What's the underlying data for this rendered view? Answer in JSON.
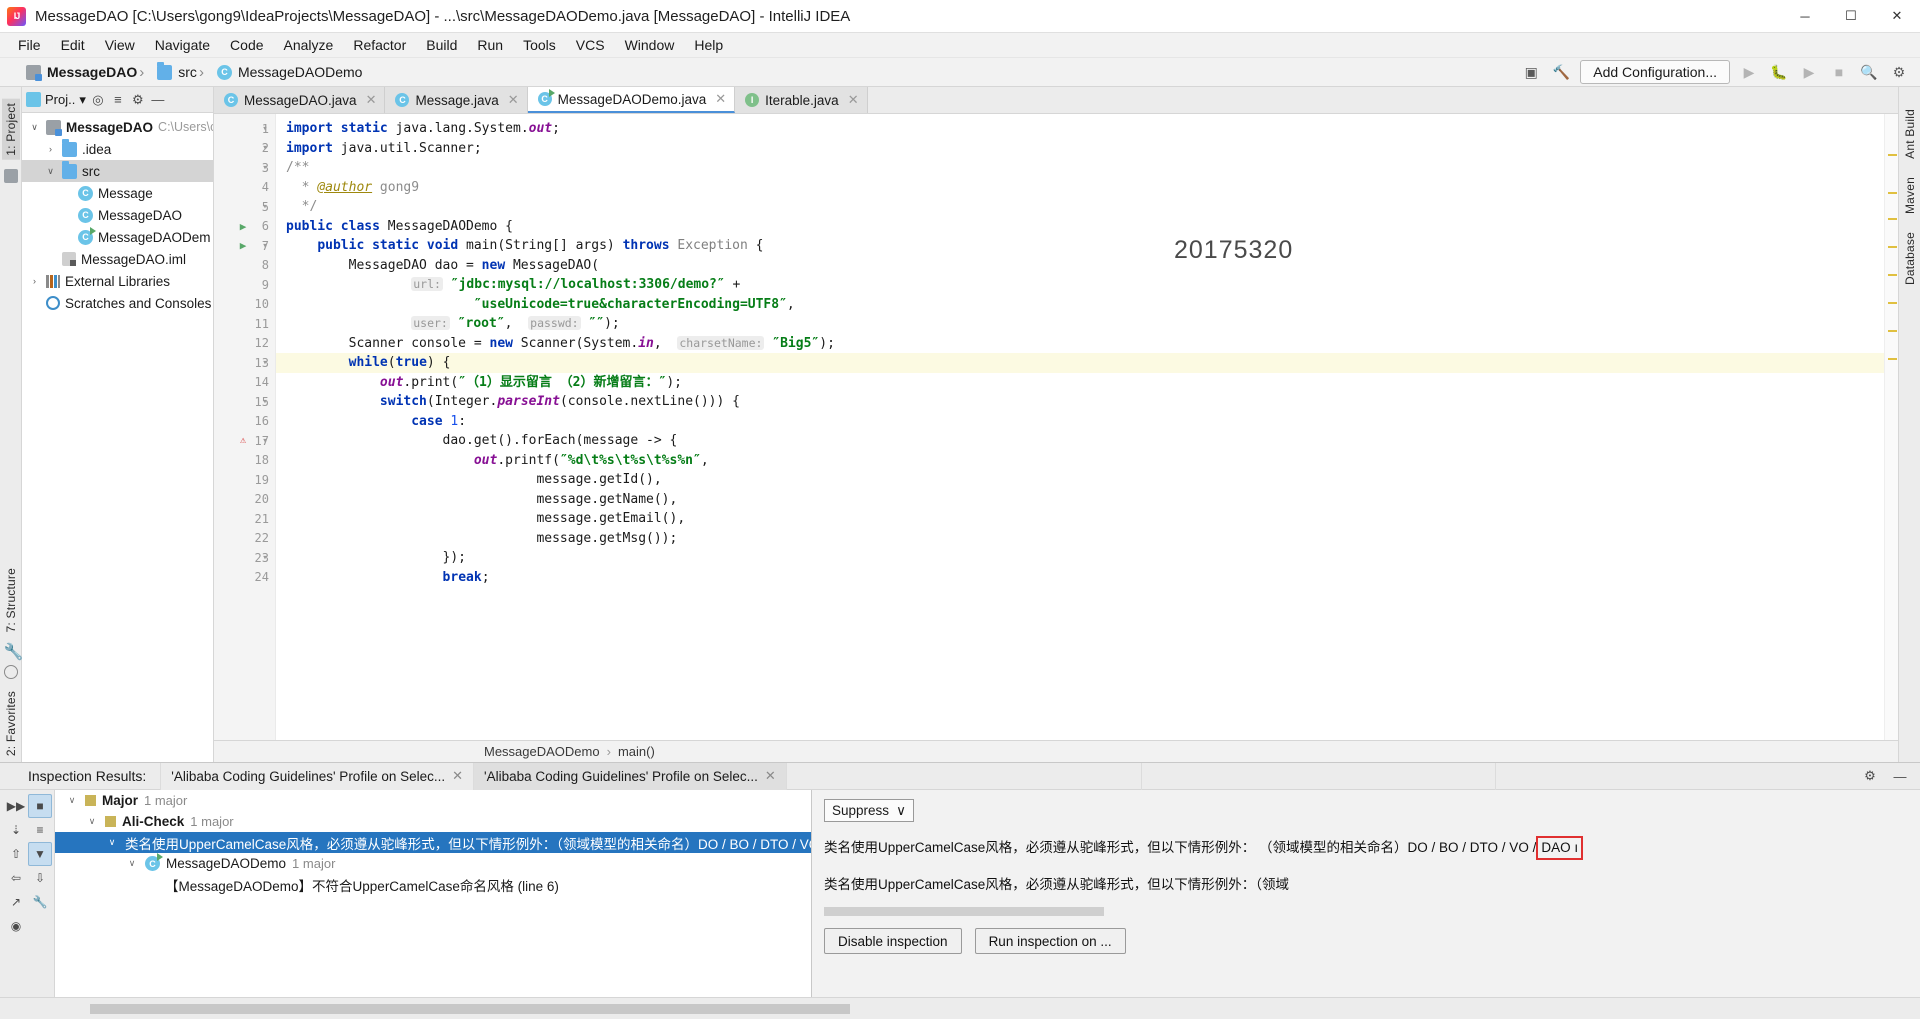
{
  "window": {
    "title": "MessageDAO [C:\\Users\\gong9\\IdeaProjects\\MessageDAO] - ...\\src\\MessageDAODemo.java [MessageDAO] - IntelliJ IDEA",
    "logo_label": "intellij-idea-logo",
    "minimize": "─",
    "maximize": "☐",
    "close": "✕"
  },
  "menu": {
    "items": [
      "File",
      "Edit",
      "View",
      "Navigate",
      "Code",
      "Analyze",
      "Refactor",
      "Build",
      "Run",
      "Tools",
      "VCS",
      "Window",
      "Help"
    ]
  },
  "navbar": {
    "crumbs": [
      {
        "label": "MessageDAO",
        "icon": "module-icon"
      },
      {
        "label": "src",
        "icon": "folder-icon"
      },
      {
        "label": "MessageDAODemo",
        "icon": "java-class-icon"
      }
    ],
    "run_configuration": "Add Configuration...",
    "icons": [
      "preview-icon",
      "build-icon",
      "run-icon",
      "debug-icon",
      "coverage-icon",
      "stop-icon",
      "search-icon",
      "settings-icon"
    ]
  },
  "project_pane": {
    "header": {
      "title": "Proj..",
      "dropdown": "▾",
      "icons": [
        "locate-icon",
        "collapse-all-icon",
        "settings-icon",
        "hide-icon"
      ]
    },
    "tree": [
      {
        "label": "MessageDAO",
        "path": "C:\\Users\\c",
        "twist": "∨",
        "icon": "module-icon",
        "depth": 0,
        "bold": true,
        "selected": false
      },
      {
        "label": ".idea",
        "path": "",
        "twist": "›",
        "icon": "folder-icon",
        "depth": 1,
        "bold": false,
        "selected": false
      },
      {
        "label": "src",
        "path": "",
        "twist": "∨",
        "icon": "folder-icon",
        "depth": 1,
        "bold": false,
        "selected": true
      },
      {
        "label": "Message",
        "path": "",
        "twist": "",
        "icon": "java-class-icon",
        "depth": 2,
        "bold": false,
        "selected": false
      },
      {
        "label": "MessageDAO",
        "path": "",
        "twist": "",
        "icon": "java-class-icon",
        "depth": 2,
        "bold": false,
        "selected": false
      },
      {
        "label": "MessageDAODem",
        "path": "",
        "twist": "",
        "icon": "java-class-runnable-icon",
        "depth": 2,
        "bold": false,
        "selected": false
      },
      {
        "label": "MessageDAO.iml",
        "path": "",
        "twist": "",
        "icon": "iml-file-icon",
        "depth": 1,
        "bold": false,
        "selected": false
      },
      {
        "label": "External Libraries",
        "path": "",
        "twist": "›",
        "icon": "library-icon",
        "depth": 0,
        "bold": false,
        "selected": false
      },
      {
        "label": "Scratches and Consoles",
        "path": "",
        "twist": "",
        "icon": "scratch-icon",
        "depth": 0,
        "bold": false,
        "selected": false
      }
    ]
  },
  "left_strip": {
    "project_label": "1: Project",
    "structure_label": "7: Structure",
    "favorites_label": "2: Favorites"
  },
  "right_strip": {
    "labels": [
      "Ant Build",
      "Maven",
      "Database"
    ]
  },
  "editor": {
    "tabs": [
      {
        "label": "MessageDAO.java",
        "icon": "java-class-icon",
        "active": false,
        "close": "✕"
      },
      {
        "label": "Message.java",
        "icon": "java-class-icon",
        "active": false,
        "close": "✕"
      },
      {
        "label": "MessageDAODemo.java",
        "icon": "java-class-runnable-icon",
        "active": true,
        "close": "✕"
      },
      {
        "label": "Iterable.java",
        "icon": "java-interface-icon",
        "active": false,
        "close": "✕"
      }
    ],
    "watermark": "20175320",
    "breadcrumb": [
      "MessageDAODemo",
      "main()"
    ],
    "lines": [
      {
        "n": 1,
        "marker": "fold",
        "html": "<span class=\"kw\">import</span> <span class=\"kw\">static</span> java.lang.System.<span class=\"fld\">out</span>;"
      },
      {
        "n": 2,
        "marker": "fold",
        "html": "<span class=\"kw\">import</span> java.util.Scanner;"
      },
      {
        "n": 3,
        "marker": "fold",
        "html": "<span class=\"doc\">/**</span>"
      },
      {
        "n": 4,
        "marker": "",
        "html": "  <span class=\"doc\">* </span><span class=\"anno\">@author</span><span class=\"doc\"> gong9</span>"
      },
      {
        "n": 5,
        "marker": "fold",
        "html": "  <span class=\"doc\">*/</span>"
      },
      {
        "n": 6,
        "marker": "run",
        "html": "<span class=\"kw\">public class</span> MessageDAODemo {"
      },
      {
        "n": 7,
        "marker": "run-fold",
        "html": "    <span class=\"kw\">public static void</span> main(String[] args) <span class=\"kw\">throws</span> <span class=\"gray\">Exception</span> {"
      },
      {
        "n": 8,
        "marker": "",
        "html": "        MessageDAO dao = <span class=\"kw\">new</span> MessageDAO("
      },
      {
        "n": 9,
        "marker": "",
        "html": "                <span class=\"hint\">url:</span> <span class=\"str\">″jdbc:mysql://localhost:3306/demo?″</span> +"
      },
      {
        "n": 10,
        "marker": "",
        "html": "                        <span class=\"str\">″useUnicode=true&amp;characterEncoding=UTF8″</span>,"
      },
      {
        "n": 11,
        "marker": "",
        "html": "                <span class=\"hint\">user:</span> <span class=\"str\">″root″</span>,  <span class=\"hint\">passwd:</span> <span class=\"str\">″″</span>);"
      },
      {
        "n": 12,
        "marker": "",
        "html": "        Scanner console = <span class=\"kw\">new</span> Scanner(System.<span class=\"fld\">in</span>,  <span class=\"hint\">charsetName:</span> <span class=\"str\">″Big5″</span>);"
      },
      {
        "n": 13,
        "marker": "fold",
        "html": "        <span class=\"kw\">while</span>(<span class=\"kw\">true</span>) <span class=\"hlbr\">{</span>",
        "highlight": true
      },
      {
        "n": 14,
        "marker": "",
        "html": "            <span class=\"fld\">out</span>.print(<span class=\"str\">″（1）显示留言 （2）新增留言：″</span>);"
      },
      {
        "n": 15,
        "marker": "fold",
        "html": "            <span class=\"kw\">switch</span>(Integer.<span class=\"fld\">parseInt</span>(console.nextLine())) {"
      },
      {
        "n": 16,
        "marker": "",
        "html": "                <span class=\"kw\">case</span> <span class=\"num\">1</span>:"
      },
      {
        "n": 17,
        "marker": "error-fold",
        "html": "                    dao.get().forEach(message -&gt; {"
      },
      {
        "n": 18,
        "marker": "",
        "html": "                        <span class=\"fld\">out</span>.printf(<span class=\"str\">″%d\\t%s\\t%s\\t%s%n″</span>,"
      },
      {
        "n": 19,
        "marker": "",
        "html": "                                message.getId(),"
      },
      {
        "n": 20,
        "marker": "",
        "html": "                                message.getName(),"
      },
      {
        "n": 21,
        "marker": "",
        "html": "                                message.getEmail(),"
      },
      {
        "n": 22,
        "marker": "",
        "html": "                                message.getMsg());"
      },
      {
        "n": 23,
        "marker": "fold",
        "html": "                    });"
      },
      {
        "n": 24,
        "marker": "",
        "html": "                    <span class=\"kw\">break</span>;"
      }
    ]
  },
  "inspection": {
    "title": "Inspection Results:",
    "tabs": [
      {
        "label": "'Alibaba Coding Guidelines' Profile on Selec...",
        "active": false,
        "close": "✕"
      },
      {
        "label": "'Alibaba Coding Guidelines' Profile on Selec...",
        "active": true,
        "close": "✕"
      }
    ],
    "header_icons": [
      "settings-icon",
      "hide-icon"
    ],
    "toolbar_icons": [
      "rerun-icon",
      "highlight-icon",
      "export-icon",
      "group-icon",
      "filter-icon",
      "expand-icon",
      "collapse-icon",
      "prev-icon",
      "next-icon",
      "autofix-icon",
      "edit-settings-icon"
    ],
    "tree": [
      {
        "label": "Major",
        "count": "1 major",
        "depth": 0,
        "twist": "∨",
        "icon": "severity-box",
        "bold": true,
        "selected": false
      },
      {
        "label": "Ali-Check",
        "count": "1 major",
        "depth": 1,
        "twist": "∨",
        "icon": "severity-box",
        "bold": true,
        "selected": false
      },
      {
        "label": "类名使用UpperCamelCase风格，必须遵从驼峰形式，但以下情形例外：（领域模型的相关命名）DO / BO / DTO / VO / DA",
        "count": "",
        "depth": 2,
        "twist": "∨",
        "icon": "",
        "bold": false,
        "selected": true
      },
      {
        "label": "MessageDAODemo",
        "count": "1 major",
        "depth": 3,
        "twist": "∨",
        "icon": "java-class-runnable-icon",
        "bold": false,
        "selected": false
      },
      {
        "label": "【MessageDAODemo】不符合UpperCamelCase命名风格 (line 6)",
        "count": "",
        "depth": 4,
        "twist": "",
        "icon": "",
        "bold": false,
        "selected": false
      }
    ],
    "description": {
      "suppress_label": "Suppress",
      "suppress_caret": "∨",
      "main_text": "类名使用UpperCamelCase风格，必须遵从驼峰形式，但以下情形例外： （领域模型的相关命名）DO / BO / DTO / VO / ",
      "highlight_text": "DAO ı",
      "sub_text": "类名使用UpperCamelCase风格，必须遵从驼峰形式，但以下情形例外：（领域",
      "buttons": [
        "Disable inspection",
        "Run inspection on ..."
      ]
    }
  }
}
